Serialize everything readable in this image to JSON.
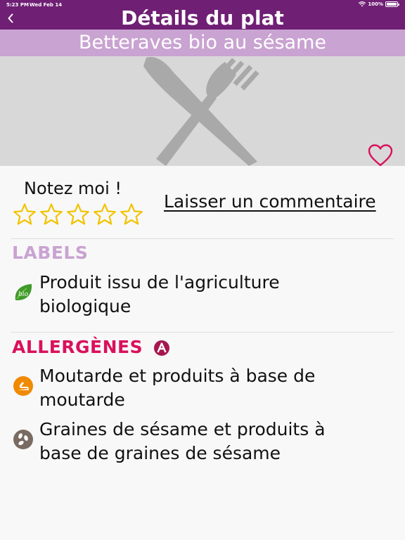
{
  "status_bar": {
    "time": "5:23 PM",
    "date": "Wed Feb 14",
    "battery": "100%"
  },
  "nav": {
    "title": "Détails du plat",
    "back_icon": "chevron-left-icon"
  },
  "dish": {
    "name": "Betteraves bio au sésame",
    "image_placeholder_icon": "fork-knife-icon",
    "favorite_icon": "heart-outline-icon"
  },
  "rating": {
    "label": "Notez moi !",
    "stars": 0,
    "max_stars": 5
  },
  "comment": {
    "link_label": "Laisser un commentaire"
  },
  "labels": {
    "title": "LABELS",
    "items": [
      {
        "text": "Produit issu de l'agriculture biologique",
        "icon": "bio-leaf-icon"
      }
    ]
  },
  "allergens": {
    "title": "ALLERGÈNES",
    "badge_icon": "allergen-a-badge-icon",
    "items": [
      {
        "text": "Moutarde et produits à base de moutarde",
        "icon": "mustard-icon"
      },
      {
        "text": "Graines de sésame et produits à base de graines de sésame",
        "icon": "sesame-seeds-icon"
      }
    ]
  },
  "colors": {
    "primary": "#6f1f74",
    "secondary": "#c9a3d1",
    "accent": "#d9115c",
    "star": "#f2c300"
  }
}
